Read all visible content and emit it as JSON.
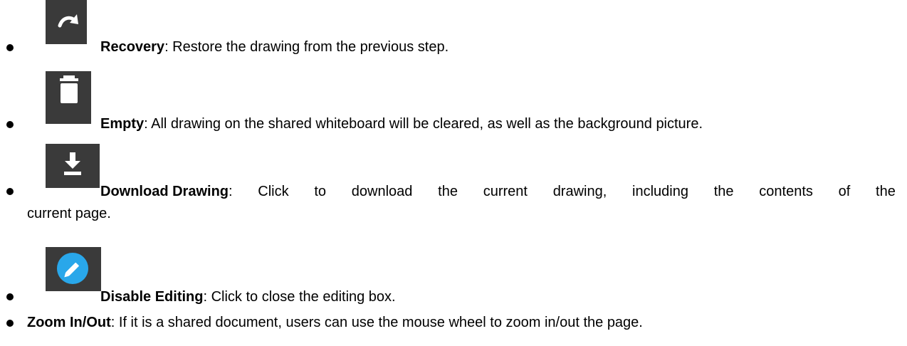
{
  "items": [
    {
      "icon": "redo-arrow-icon",
      "term": "Recovery",
      "sep": ":",
      "desc": " Restore the drawing from the previous step."
    },
    {
      "icon": "trash-icon",
      "term": "Empty",
      "sep": ":",
      "desc": " All drawing on the shared whiteboard will be cleared, as well as the background picture."
    },
    {
      "icon": "download-icon",
      "term": "Download Drawing",
      "sep": ":",
      "desc_words": [
        "Click",
        "to",
        "download",
        "the",
        "current",
        "drawing,",
        "including",
        "the",
        "contents",
        "of",
        "the"
      ],
      "desc_cont": "current page."
    },
    {
      "icon": "pencil-circle-icon",
      "term": "Disable Editing",
      "sep": ":",
      "desc": " Click to close the editing box."
    },
    {
      "term": "Zoom In/Out",
      "sep": ":",
      "desc": " If it is a shared document, users can use the mouse wheel to zoom in/out the page."
    }
  ],
  "colors": {
    "tile": "#3a3a3a",
    "pencil_circle": "#29a7ea",
    "icon_fg": "#ffffff"
  }
}
